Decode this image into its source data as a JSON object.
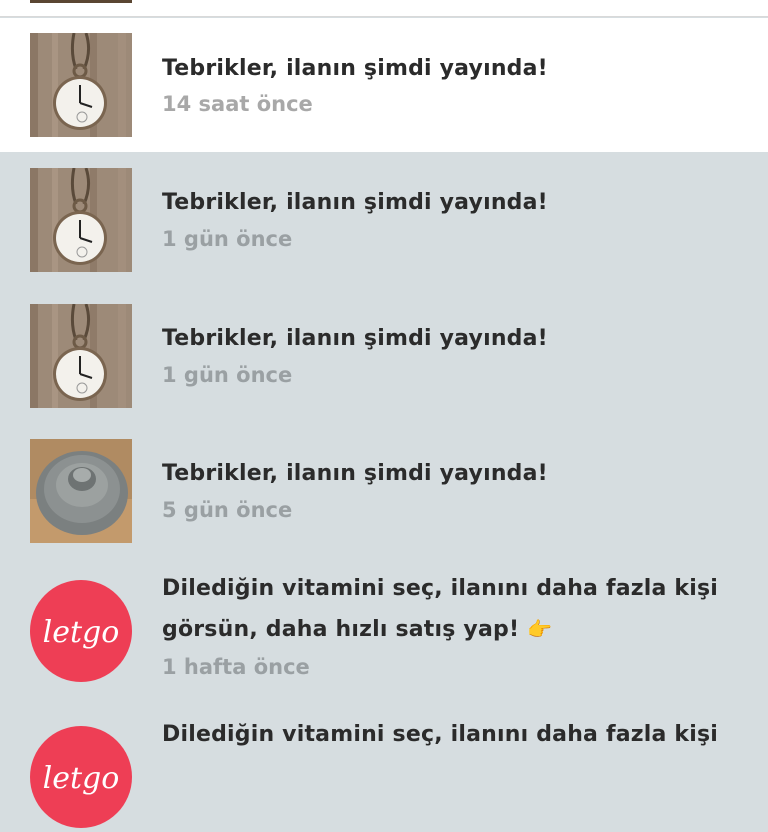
{
  "colors": {
    "read_bg": "#ffffff",
    "unread_bg": "#d6dde0",
    "title_text": "#2b2b2b",
    "time_text": "#9aa0a3",
    "brand_red": "#ee3e55"
  },
  "notifications": [
    {
      "title": "Tebrikler, ilanın şimdi yayında!",
      "time": "14 saat önce",
      "read": true,
      "thumb": "pocket-watch"
    },
    {
      "title": "Tebrikler, ilanın şimdi yayında!",
      "time": "1 gün önce",
      "read": false,
      "thumb": "pocket-watch"
    },
    {
      "title": "Tebrikler, ilanın şimdi yayında!",
      "time": "1 gün önce",
      "read": false,
      "thumb": "pocket-watch"
    },
    {
      "title": "Tebrikler, ilanın şimdi yayında!",
      "time": "5 gün önce",
      "read": false,
      "thumb": "metal-cap"
    },
    {
      "title_line1": "Dilediğin vitamini seç, ilanını daha fazla kişi",
      "title_line2": "görsün, daha hızlı satış yap!",
      "emoji": "👉",
      "time": "1 hafta önce",
      "read": false,
      "thumb": "letgo-logo"
    },
    {
      "title_line1": "Dilediğin vitamini seç, ilanını daha fazla kişi",
      "read": false,
      "thumb": "letgo-logo"
    }
  ],
  "brand": {
    "logo_text": "letgo"
  }
}
